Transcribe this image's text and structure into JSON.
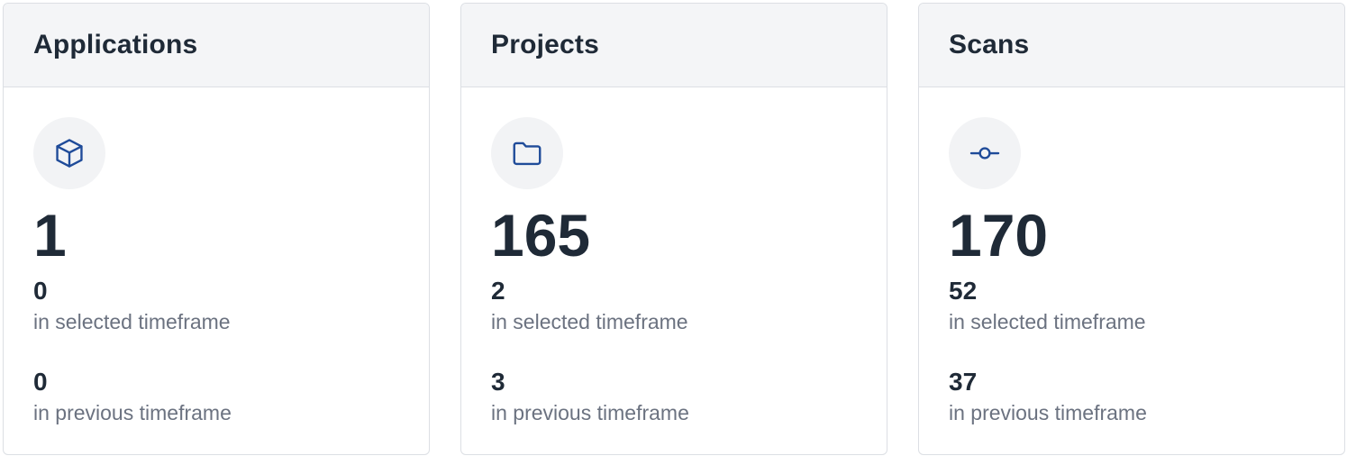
{
  "cards": [
    {
      "title": "Applications",
      "icon": "cube-icon",
      "total": "1",
      "selected_value": "0",
      "selected_label": "in selected timeframe",
      "previous_value": "0",
      "previous_label": "in previous timeframe"
    },
    {
      "title": "Projects",
      "icon": "folder-icon",
      "total": "165",
      "selected_value": "2",
      "selected_label": "in selected timeframe",
      "previous_value": "3",
      "previous_label": "in previous timeframe"
    },
    {
      "title": "Scans",
      "icon": "commit-icon",
      "total": "170",
      "selected_value": "52",
      "selected_label": "in selected timeframe",
      "previous_value": "37",
      "previous_label": "in previous timeframe"
    }
  ],
  "colors": {
    "icon_stroke": "#1f4b99",
    "header_bg": "#f4f5f7",
    "border": "#dcdfe4",
    "text_primary": "#1f2a37",
    "text_secondary": "#6b7280"
  }
}
